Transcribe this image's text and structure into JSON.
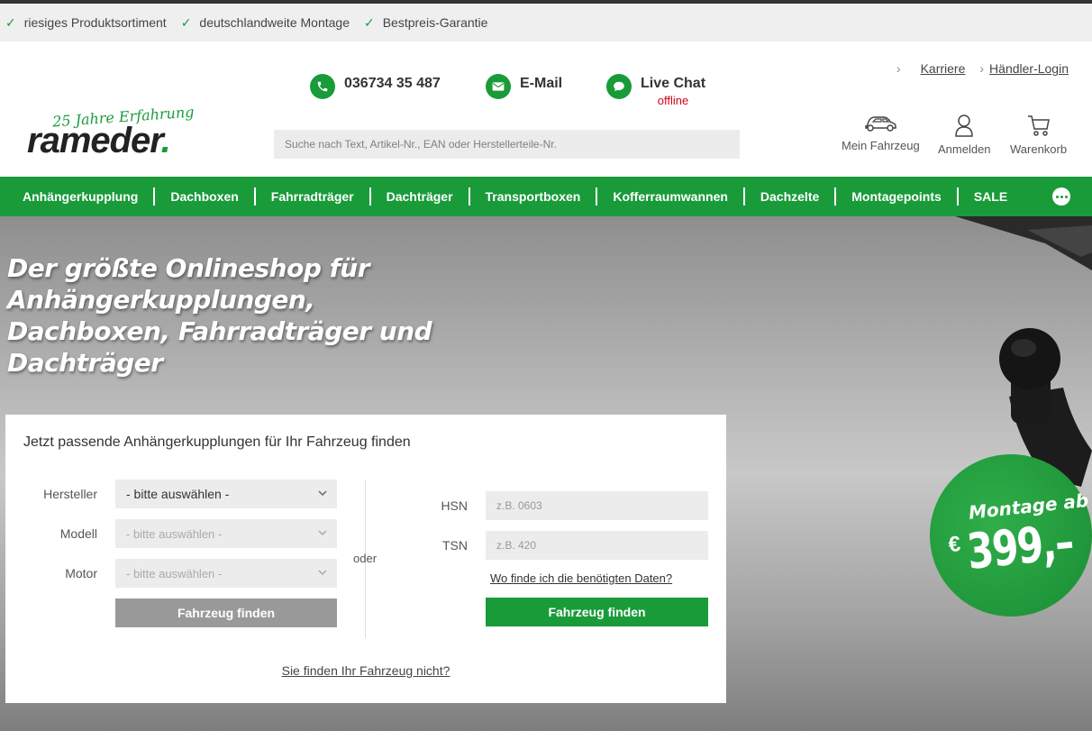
{
  "usp": [
    {
      "label": "riesiges Produktsortiment"
    },
    {
      "label": "deutschlandweite Montage"
    },
    {
      "label": "Bestpreis-Garantie"
    }
  ],
  "logo": {
    "tagline": "25 Jahre Erfahrung",
    "name": "rameder",
    "dot": "."
  },
  "contact": {
    "phone": "036734 35 487",
    "email": "E-Mail",
    "chat": "Live Chat",
    "chat_status": "offline"
  },
  "meta_links": [
    {
      "label": "Karriere"
    },
    {
      "label": "Händler-Login"
    }
  ],
  "search": {
    "placeholder": "Suche nach Text, Artikel-Nr., EAN oder Herstellerteile-Nr."
  },
  "quick_links": [
    {
      "label": "Mein Fahrzeug",
      "icon": "car-icon"
    },
    {
      "label": "Anmelden",
      "icon": "user-icon"
    },
    {
      "label": "Warenkorb",
      "icon": "cart-icon"
    }
  ],
  "nav": [
    "Anhängerkupplung",
    "Dachboxen",
    "Fahrradträger",
    "Dachträger",
    "Transportboxen",
    "Kofferraumwannen",
    "Dachzelte",
    "Montagepoints",
    "SALE"
  ],
  "hero": {
    "line1": "Der größte Onlineshop für",
    "line2": "Anhängerkupplungen,",
    "line3": "Dachboxen, Fahrradträger und",
    "line4": "Dachträger"
  },
  "finder": {
    "title": "Jetzt passende Anhängerkupplungen für Ihr Fahrzeug finden",
    "hersteller_label": "Hersteller",
    "hersteller_value": "- bitte auswählen -",
    "modell_label": "Modell",
    "modell_value": "- bitte auswählen -",
    "motor_label": "Motor",
    "motor_value": "- bitte auswählen -",
    "find_button_left": "Fahrzeug finden",
    "oder": "oder",
    "hsn_label": "HSN",
    "hsn_placeholder": "z.B. 0603",
    "tsn_label": "TSN",
    "tsn_placeholder": "z.B. 420",
    "help_link": "Wo finde ich die benötigten Daten?",
    "find_button_right": "Fahrzeug finden",
    "not_found": "Sie finden Ihr Fahrzeug nicht?"
  },
  "badge": {
    "line1": "Montage ab",
    "currency": "€",
    "price": "399,–"
  },
  "colors": {
    "brand_green": "#1a9b3a",
    "offline_red": "#d0021b"
  }
}
